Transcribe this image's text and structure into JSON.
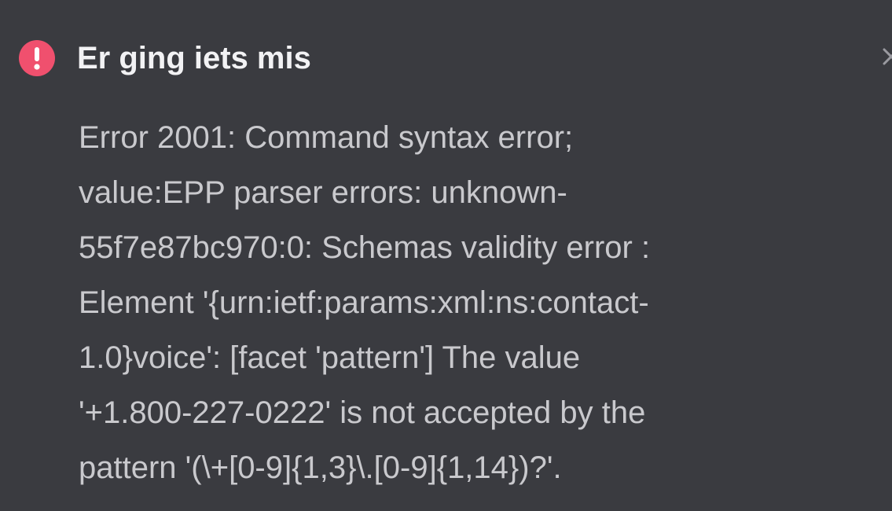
{
  "toast": {
    "title": "Er ging iets mis",
    "icon": "exclamation-circle-icon",
    "close_icon": "close-icon",
    "message": "Error 2001: Command syntax error;\nvalue:EPP parser errors: unknown-\n55f7e87bc970:0: Schemas validity error :\nElement '{urn:ietf:params:xml:ns:contact-\n1.0}voice': [facet 'pattern'] The value\n'+1.800-227-0222' is not accepted by the\npattern '(\\+[0-9]{1,3}\\.[0-9]{1,14})?'.",
    "colors": {
      "background": "#3a3b40",
      "icon": "#f0506e",
      "title": "#f2f2f4",
      "message": "#c9c9cd"
    }
  }
}
